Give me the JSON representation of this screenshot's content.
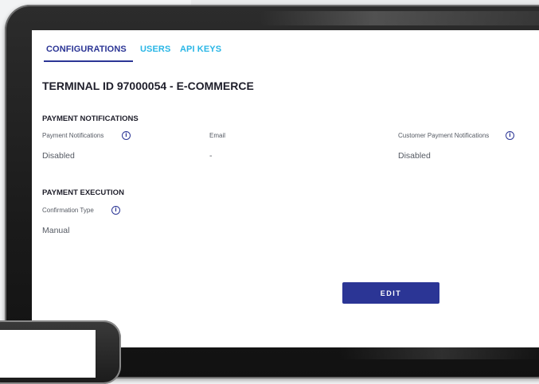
{
  "tabs": [
    {
      "label": "CONFIGURATIONS"
    },
    {
      "label": "USERS"
    },
    {
      "label": "API KEYS"
    }
  ],
  "page": {
    "title": "TERMINAL ID 97000054 - E-COMMERCE"
  },
  "payment_notifications": {
    "heading": "PAYMENT NOTIFICATIONS",
    "fields": [
      {
        "label": "Payment Notifications",
        "value": "Disabled"
      },
      {
        "label": "Email",
        "value": "-"
      },
      {
        "label": "Customer Payment Notifications",
        "value": "Disabled"
      }
    ]
  },
  "payment_execution": {
    "heading": "PAYMENT EXECUTION",
    "fields": [
      {
        "label": "Confirmation Type",
        "value": "Manual"
      }
    ]
  },
  "actions": {
    "edit_label": "EDIT"
  },
  "icons": {
    "info": "info-icon",
    "info_glyph": "i"
  },
  "colors": {
    "primary": "#2b3595",
    "tab_inactive": "#29b6e6",
    "text": "#1e1e2a",
    "muted": "#555a63"
  }
}
